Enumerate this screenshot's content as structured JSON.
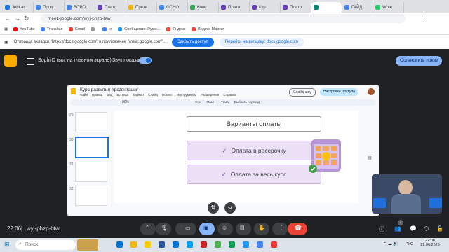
{
  "browser": {
    "tabs": [
      {
        "label": "JobLat",
        "color": "#1a73e8"
      },
      {
        "label": "Прод",
        "color": "#4285f4"
      },
      {
        "label": "ВОРО",
        "color": "#4285f4"
      },
      {
        "label": "Плато",
        "color": "#673ab7"
      },
      {
        "label": "Прези",
        "color": "#f4b400"
      },
      {
        "label": "ОСНО",
        "color": "#4285f4"
      },
      {
        "label": "Копи",
        "color": "#34a853"
      },
      {
        "label": "Плато",
        "color": "#673ab7"
      },
      {
        "label": "Кур",
        "color": "#673ab7"
      },
      {
        "label": "Плато",
        "color": "#673ab7"
      },
      {
        "label": "",
        "color": "#00897b"
      },
      {
        "label": "ГАЙД",
        "color": "#4285f4"
      },
      {
        "label": "What",
        "color": "#25d366"
      }
    ],
    "url": "meet.google.com/wyj-phzp-btw",
    "bookmarks": [
      "YouTube",
      "Translate",
      "Gmail",
      "",
      "cт",
      "Сообщение: Русск...",
      "Яндекс",
      "Яндекс Маркет"
    ],
    "infobar_text": "Отправка вкладки \"https://docs.google.com\" в приложение \"meet.google.com\"...",
    "infobar_btn_stop": "Закрыть доступ",
    "infobar_btn_switch": "Перейти на вкладку: docs.google.com"
  },
  "meet": {
    "presenter_text": "Sophi D (вы, на главном экране)",
    "sound_label": "Звук показа",
    "stop_button": "Остановить показ",
    "time": "22:06",
    "code": "wyj-phzp-btw",
    "participants_count": "2"
  },
  "slides": {
    "doc_title": "Курс развития-презентация",
    "menu": [
      "Файл",
      "Правка",
      "Вид",
      "Вставка",
      "Формат",
      "Слайд",
      "Объект",
      "Инструменты",
      "Расширения",
      "Справка"
    ],
    "slideshow_btn": "Слайд-шоу",
    "share_btn": "Настройки Доступа",
    "zoom": "90%",
    "toolbar_items": [
      "Фон",
      "Макет",
      "Тема",
      "Выбрать переход"
    ],
    "slide_numbers": [
      "29",
      "30",
      "31",
      "32"
    ],
    "heading": "Варианты оплаты",
    "option1": "Оплата в рассрочку",
    "option2": "Оплата за весь курс"
  },
  "taskbar": {
    "search_placeholder": "Поиск",
    "lang": "РУС",
    "clock_time": "22:06",
    "clock_date": "21.06.2025"
  }
}
